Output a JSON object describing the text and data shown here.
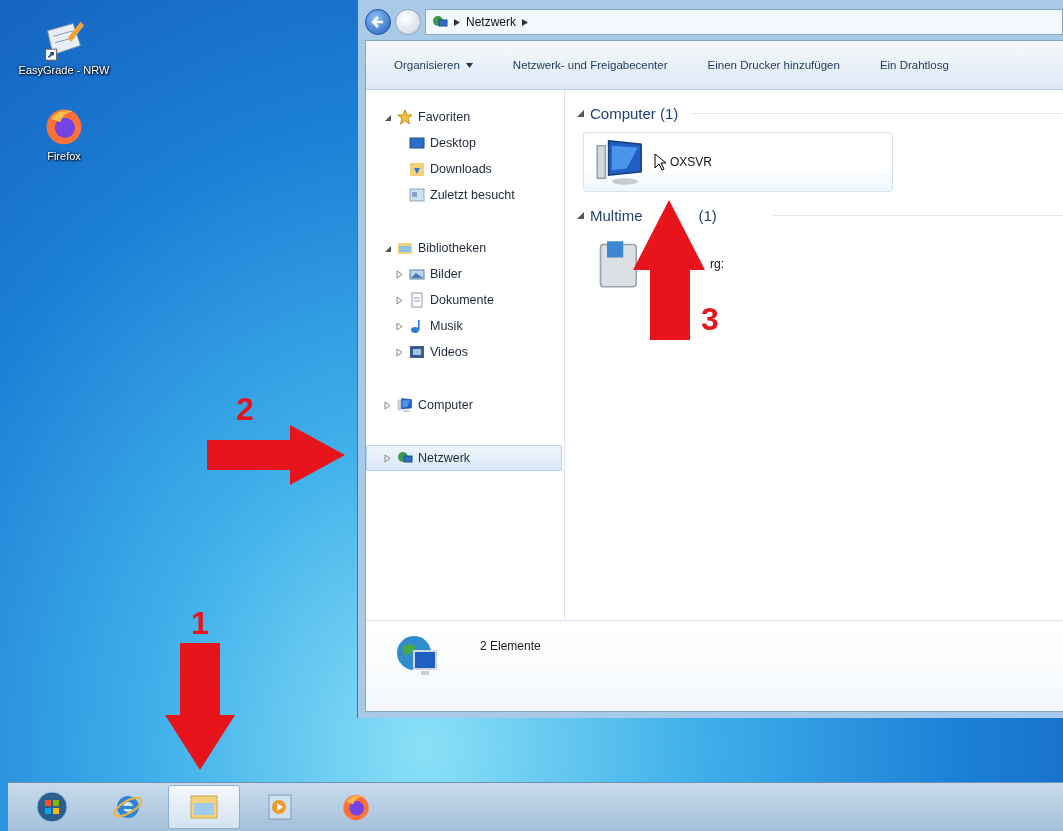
{
  "desktop_icons": [
    {
      "kind": "grade",
      "label": "EasyGrade - NRW"
    },
    {
      "kind": "firefox",
      "label": "Firefox"
    }
  ],
  "explorer": {
    "breadcrumb": [
      "Netzwerk"
    ],
    "toolbar": [
      {
        "label": "Organisieren",
        "dropdown": true
      },
      {
        "label": "Netzwerk- und Freigabecenter",
        "dropdown": false
      },
      {
        "label": "Einen Drucker hinzufügen",
        "dropdown": false
      },
      {
        "label": "Ein Drahtlosg",
        "dropdown": false
      }
    ],
    "nav": [
      {
        "label": "Favoriten",
        "kind": "star",
        "expanded": true,
        "selected": false,
        "children": [
          {
            "label": "Desktop",
            "kind": "desktop",
            "selected": false
          },
          {
            "label": "Downloads",
            "kind": "downloads",
            "selected": false
          },
          {
            "label": "Zuletzt besucht",
            "kind": "recent",
            "selected": false
          }
        ]
      },
      {
        "label": "Bibliotheken",
        "kind": "library",
        "expanded": true,
        "selected": false,
        "children": [
          {
            "label": "Bilder",
            "kind": "pictures",
            "expanded": false,
            "selected": false
          },
          {
            "label": "Dokumente",
            "kind": "documents",
            "expanded": false,
            "selected": false
          },
          {
            "label": "Musik",
            "kind": "music",
            "expanded": false,
            "selected": false
          },
          {
            "label": "Videos",
            "kind": "videos",
            "expanded": false,
            "selected": false
          }
        ]
      },
      {
        "label": "Computer",
        "kind": "computer",
        "expanded": false,
        "selected": false
      },
      {
        "label": "Netzwerk",
        "kind": "network",
        "expanded": false,
        "selected": true
      }
    ],
    "groups": [
      {
        "title_parts": [
          "Computer (1)"
        ],
        "items": [
          {
            "kind": "computer",
            "label": "OXSVR",
            "hovered": true,
            "cursor": true
          }
        ]
      },
      {
        "title_parts": [
          "Multime",
          "(1)"
        ],
        "items": [
          {
            "kind": "media-device",
            "label": "rg:",
            "hovered": false,
            "cursor": false
          }
        ]
      }
    ],
    "details": {
      "count": "2 Elemente"
    }
  },
  "taskbar": [
    {
      "kind": "start",
      "selected": false
    },
    {
      "kind": "browser",
      "selected": false
    },
    {
      "kind": "explorer",
      "selected": true
    },
    {
      "kind": "media",
      "selected": false
    },
    {
      "kind": "firefox",
      "selected": false
    }
  ],
  "annotations": [
    {
      "label": "1",
      "kind": "down"
    },
    {
      "label": "2",
      "kind": "right"
    },
    {
      "label": "3",
      "kind": "up"
    }
  ]
}
